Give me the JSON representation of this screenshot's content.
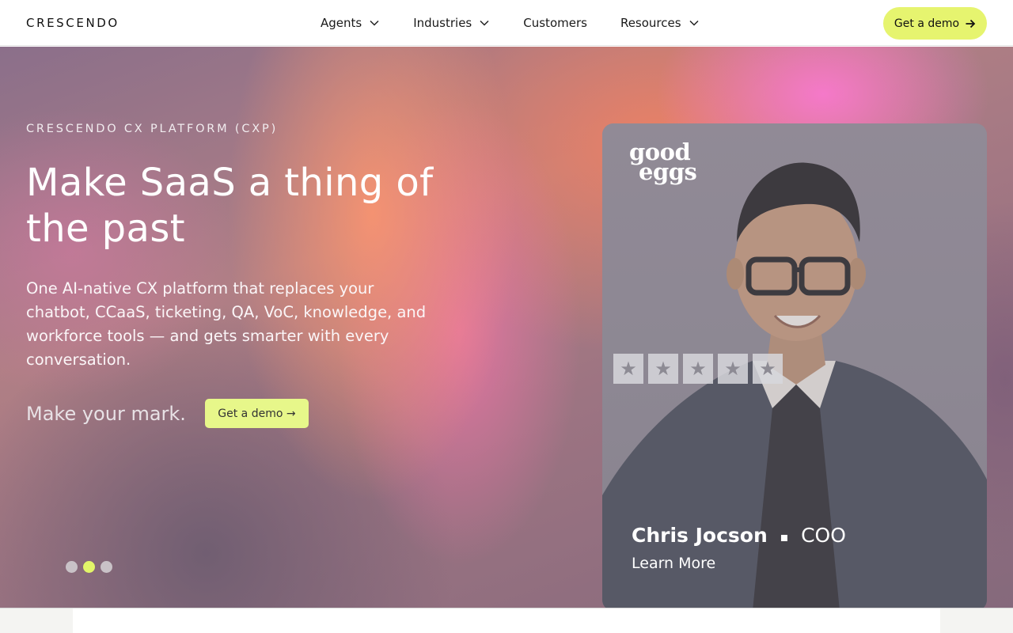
{
  "nav": {
    "logo": "CRESCENDO",
    "links": [
      {
        "label": "Agents",
        "has_dropdown": true
      },
      {
        "label": "Industries",
        "has_dropdown": true
      },
      {
        "label": "Customers",
        "has_dropdown": false
      },
      {
        "label": "Resources",
        "has_dropdown": true
      }
    ],
    "cta": "Get a demo"
  },
  "hero": {
    "eyebrow": "CRESCENDO CX PLATFORM (CXP)",
    "headline": "Make SaaS a thing of the past",
    "subcopy": "One  AI-native CX platform that replaces your chatbot, CCaaS, ticketing, QA, VoC, knowledge, and workforce tools — and gets smarter with every conversation.",
    "mark_text": "Make your mark.",
    "cta": "Get a demo →",
    "carousel": {
      "total": 3,
      "active_index": 1
    }
  },
  "card": {
    "logo_line1": "good",
    "logo_line2": "eggs",
    "name": "Chris Jocson",
    "separator": "▪",
    "role": "COO",
    "link": "Learn More",
    "stars": 5
  },
  "colors": {
    "accent": "#e6f46f",
    "dot_active": "#e2f569",
    "dot_inactive": "#c9c2c7"
  }
}
